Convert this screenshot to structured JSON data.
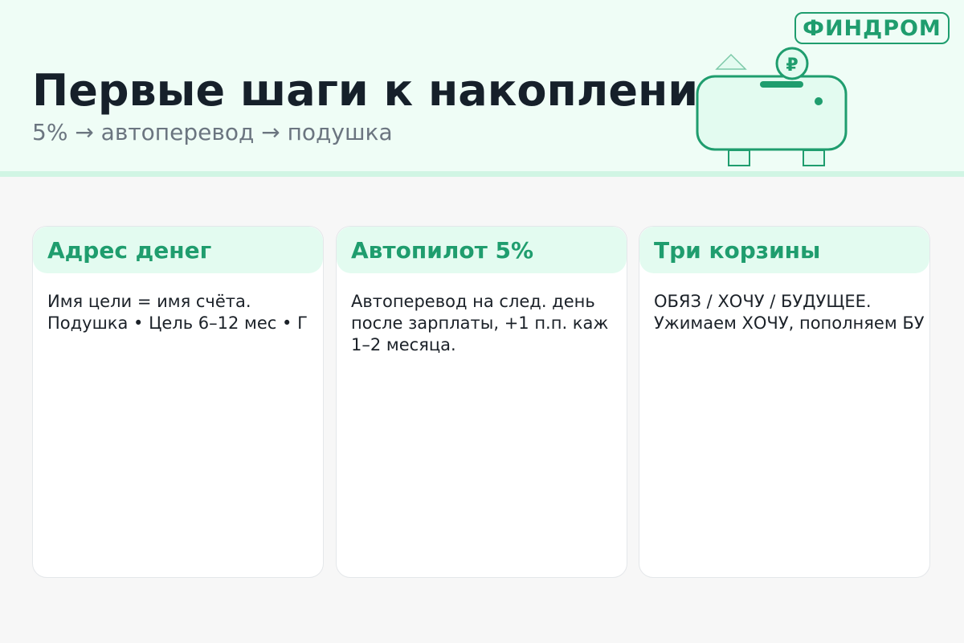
{
  "header": {
    "title": "Первые шаги к накоплениям",
    "subtitle": "5% → автоперевод → подушка",
    "brand": "ФИНДРОМ",
    "illustration": {
      "icon": "piggy-bank-icon",
      "coin_symbol": "₽"
    }
  },
  "colors": {
    "accent": "#1f9d6e",
    "header_bg": "#effdf6",
    "card_head_bg": "#e3fbf0",
    "page_bg": "#f7f7f7",
    "title_text": "#16202a",
    "subtitle_text": "#6b7580"
  },
  "cards": [
    {
      "title": "Адрес денег",
      "lines": [
        "Имя цели = имя счёта.",
        "Подушка • Цель 6–12 мес • Г"
      ]
    },
    {
      "title": "Автопилот 5%",
      "lines": [
        "Автоперевод на след. день",
        "после зарплаты, +1 п.п. каж",
        "1–2 месяца."
      ]
    },
    {
      "title": "Три корзины",
      "lines": [
        "ОБЯЗ / ХОЧУ / БУДУЩЕЕ.",
        "Ужимаем ХОЧУ, пополняем БУ"
      ]
    }
  ]
}
